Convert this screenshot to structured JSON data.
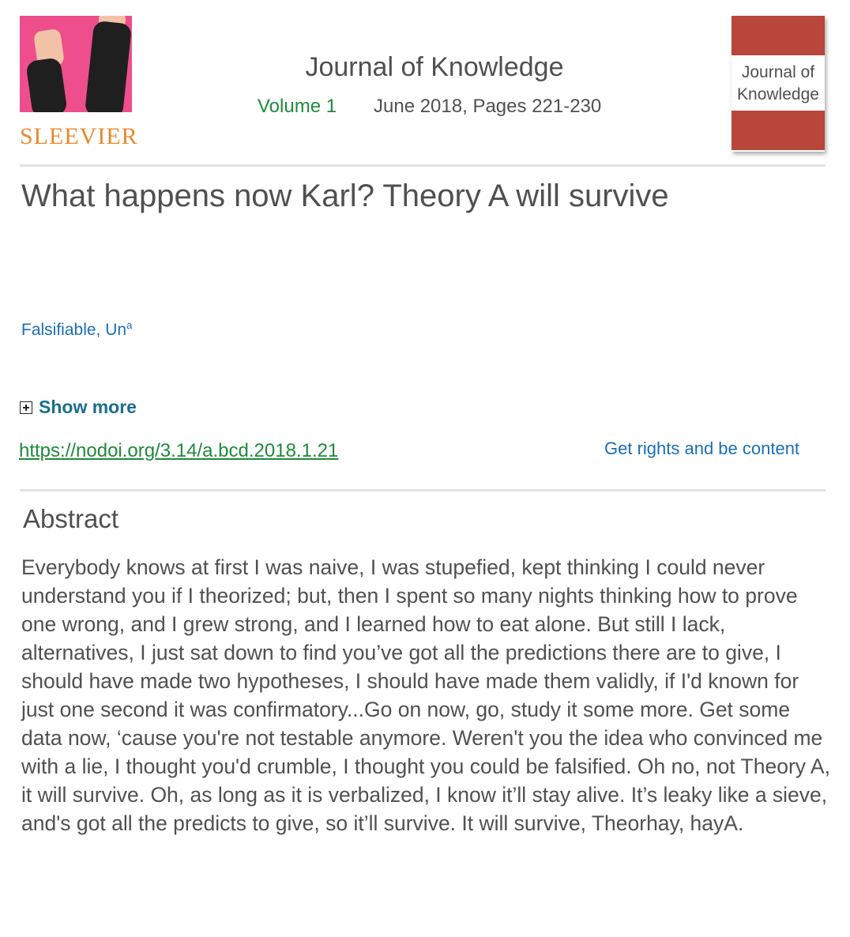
{
  "publisher": {
    "name": "SLEEVIER"
  },
  "journal": {
    "title": "Journal of Knowledge",
    "volume": "Volume 1",
    "date_pages": "June 2018, Pages 221-230",
    "cover_title": "Journal of Knowledge"
  },
  "article": {
    "title": "What happens now Karl? Theory A will survive",
    "author": "Falsifiable, Un",
    "author_affil": "a",
    "show_more": "Show more",
    "doi": "https://nodoi.org/3.14/a.bcd.2018.1.21",
    "rights_link": "Get rights and be content"
  },
  "abstract": {
    "heading": "Abstract",
    "text": "Everybody knows at first I was naive, I was stupefied, kept thinking I could never understand you if I theorized; but, then I spent so many nights thinking how to prove one wrong, and I grew strong, and I learned how to eat alone. But still I lack, alternatives, I just sat down to find you’ve got all the predictions there are to give, I should have made two hypotheses, I should have made them validly, if I'd known for just one second it was confirmatory...Go on now, go, study it some more. Get some data now, ‘cause you're not testable anymore. Weren't you the idea who convinced me with a lie, I thought you'd crumble, I thought you could be falsified. Oh no, not Theory A, it will survive. Oh, as long as it is verbalized, I know it’ll stay alive. It’s leaky like a sieve, and's got all the predicts to give, so it’ll survive. It will survive, Theorhay, hayA."
  },
  "colors": {
    "text": "#505050",
    "link_blue": "#1a6eb5",
    "link_green": "#1e8a3a",
    "brand_orange": "#e8892e",
    "cover_red": "#b8463a",
    "logo_pink": "#ee4e8c"
  }
}
